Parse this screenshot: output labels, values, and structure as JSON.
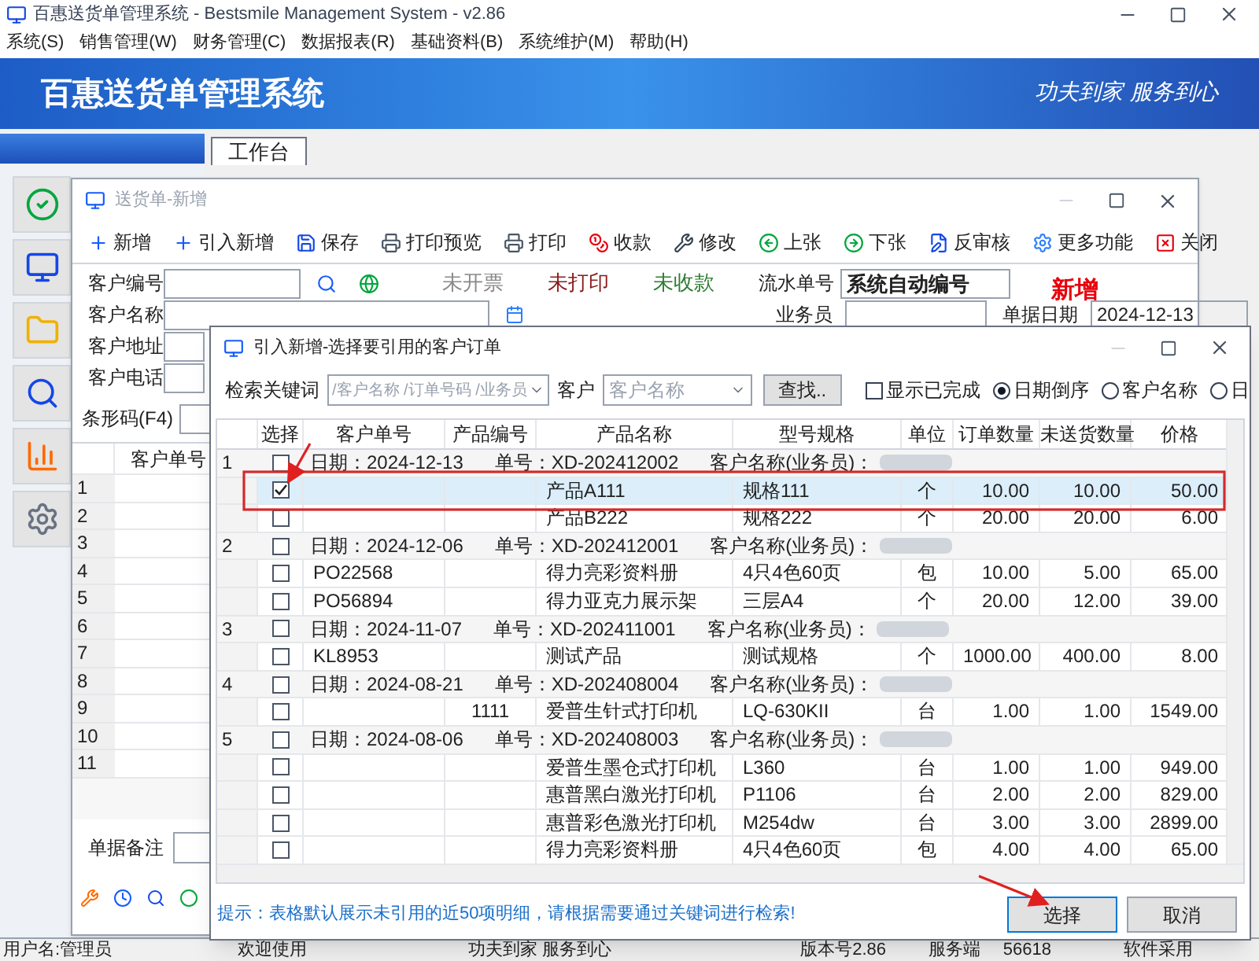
{
  "app": {
    "title": "百惠送货单管理系统 - Bestsmile Management System - v2.86",
    "menu": [
      "系统(S)",
      "销售管理(W)",
      "财务管理(C)",
      "数据报表(R)",
      "基础资料(B)",
      "系统维护(M)",
      "帮助(H)"
    ],
    "banner_title": "百惠送货单管理系统",
    "banner_slogan": "功夫到家 服务到心",
    "tabs": [
      {
        "label": "工作台",
        "selected": true
      }
    ],
    "nav_buttons": [
      {
        "kind": "check"
      },
      {
        "kind": "screens"
      },
      {
        "kind": "folder"
      },
      {
        "kind": "search"
      },
      {
        "kind": "chart"
      },
      {
        "kind": "gear"
      }
    ],
    "status_bar": [
      "用户名:管理员",
      "欢迎使用",
      "功夫到家 服务到心",
      "版本号2.86",
      "服务端",
      "56618",
      "软件采用"
    ]
  },
  "delivery_window": {
    "title": "送货单-新增",
    "toolbar": [
      {
        "label": "新增",
        "kind": "plus"
      },
      {
        "label": "引入新增",
        "kind": "plus"
      },
      {
        "label": "保存",
        "kind": "save"
      },
      {
        "label": "打印预览",
        "kind": "print"
      },
      {
        "label": "打印",
        "kind": "print"
      },
      {
        "label": "收款",
        "kind": "coins"
      },
      {
        "label": "修改",
        "kind": "wrench"
      },
      {
        "label": "上张",
        "kind": "prev"
      },
      {
        "label": "下张",
        "kind": "next"
      },
      {
        "label": "反审核",
        "kind": "edit"
      },
      {
        "label": "更多功能",
        "kind": "gear"
      },
      {
        "label": "关闭",
        "kind": "close"
      }
    ],
    "fields": [
      {
        "label": "客户编号"
      },
      {
        "label": "客户名称"
      },
      {
        "label": "客户地址"
      },
      {
        "label": "客户电话"
      }
    ],
    "statuses": [
      {
        "label": "未开票",
        "color": "#8a8a8a"
      },
      {
        "label": "未打印",
        "color": "#8b1a1a"
      },
      {
        "label": "未收款",
        "color": "#2e7d32"
      }
    ],
    "serial_label": "流水单号",
    "serial_value": "系统自动编号",
    "mode": "新增",
    "salesman_label": "业务员",
    "date_label": "单据日期",
    "date_value": "2024-12-13",
    "barcode_label": "条形码(F4)",
    "grid": {
      "columns": [
        "客户单号"
      ],
      "rows": [
        "1",
        "2",
        "3",
        "4",
        "5",
        "6",
        "7",
        "8",
        "9",
        "10",
        "11"
      ]
    },
    "remark_label": "单据备注",
    "bottom_icons": [
      {
        "kind": "wrench"
      },
      {
        "kind": "clock"
      },
      {
        "kind": "search"
      },
      {
        "kind": "circle"
      }
    ]
  },
  "order_dialog": {
    "title": "引入新增-选择要引用的客户订单",
    "keyword_label": "检索关键词",
    "keyword_placeholder": "/客户名称 /订单号码 /业务员",
    "customer_label": "客户",
    "customer_placeholder": "客户名称",
    "find_button": "查找..",
    "show_done": {
      "label": "显示已完成",
      "checked": false
    },
    "sort_options": [
      {
        "label": "日期倒序",
        "selected": true
      },
      {
        "label": "客户名称",
        "selected": false
      },
      {
        "label": "日",
        "selected": false
      }
    ],
    "columns": [
      "选择",
      "客户单号",
      "产品编号",
      "产品名称",
      "型号规格",
      "单位",
      "订单数量",
      "未送货数量",
      "价格"
    ],
    "groups": [
      {
        "number": "1",
        "checked": false,
        "date": "日期：2024-12-13",
        "order_no": "单号：XD-202412002",
        "customer": "客户名称(业务员)：",
        "items": [
          {
            "checked": true,
            "selected": true,
            "name": "产品A111",
            "spec": "规格111",
            "unit": "个",
            "qty": "10.00",
            "pending": "10.00",
            "price": "50.00"
          },
          {
            "checked": false,
            "selected": false,
            "name": "产品B222",
            "spec": "规格222",
            "unit": "个",
            "qty": "20.00",
            "pending": "20.00",
            "price": "6.00"
          }
        ]
      },
      {
        "number": "2",
        "checked": false,
        "date": "日期：2024-12-06",
        "order_no": "单号：XD-202412001",
        "customer": "客户名称(业务员)：",
        "items": [
          {
            "checked": false,
            "selected": false,
            "customer_no": "PO22568",
            "name": "得力亮彩资料册",
            "spec": "4只4色60页",
            "unit": "包",
            "qty": "10.00",
            "pending": "5.00",
            "price": "65.00"
          },
          {
            "checked": false,
            "selected": false,
            "customer_no": "PO56894",
            "name": "得力亚克力展示架",
            "spec": "三层A4",
            "unit": "个",
            "qty": "20.00",
            "pending": "12.00",
            "price": "39.00"
          }
        ]
      },
      {
        "number": "3",
        "checked": false,
        "date": "日期：2024-11-07",
        "order_no": "单号：XD-202411001",
        "customer": "客户名称(业务员)：",
        "items": [
          {
            "checked": false,
            "selected": false,
            "customer_no": "KL8953",
            "name": "测试产品",
            "spec": "测试规格",
            "unit": "个",
            "qty": "1000.00",
            "pending": "400.00",
            "price": "8.00"
          }
        ]
      },
      {
        "number": "4",
        "checked": false,
        "date": "日期：2024-08-21",
        "order_no": "单号：XD-202408004",
        "customer": "客户名称(业务员)：",
        "items": [
          {
            "checked": false,
            "selected": false,
            "product_no": "1111",
            "name": "爱普生针式打印机",
            "spec": "LQ-630KII",
            "unit": "台",
            "qty": "1.00",
            "pending": "1.00",
            "price": "1549.00"
          }
        ]
      },
      {
        "number": "5",
        "checked": false,
        "date": "日期：2024-08-06",
        "order_no": "单号：XD-202408003",
        "customer": "客户名称(业务员)：",
        "items": [
          {
            "checked": false,
            "selected": false,
            "name": "爱普生墨仓式打印机",
            "spec": "L360",
            "unit": "台",
            "qty": "1.00",
            "pending": "1.00",
            "price": "949.00"
          },
          {
            "checked": false,
            "selected": false,
            "name": "惠普黑白激光打印机",
            "spec": "P1106",
            "unit": "台",
            "qty": "2.00",
            "pending": "2.00",
            "price": "829.00"
          },
          {
            "checked": false,
            "selected": false,
            "name": "惠普彩色激光打印机",
            "spec": "M254dw",
            "unit": "台",
            "qty": "3.00",
            "pending": "3.00",
            "price": "2899.00"
          },
          {
            "checked": false,
            "selected": false,
            "name": "得力亮彩资料册",
            "spec": "4只4色60页",
            "unit": "包",
            "qty": "4.00",
            "pending": "4.00",
            "price": "65.00"
          }
        ]
      }
    ],
    "hint": "提示：表格默认展示未引用的近50项明细，请根据需要通过关键词进行检索!",
    "buttons": [
      "选择",
      "取消"
    ]
  }
}
